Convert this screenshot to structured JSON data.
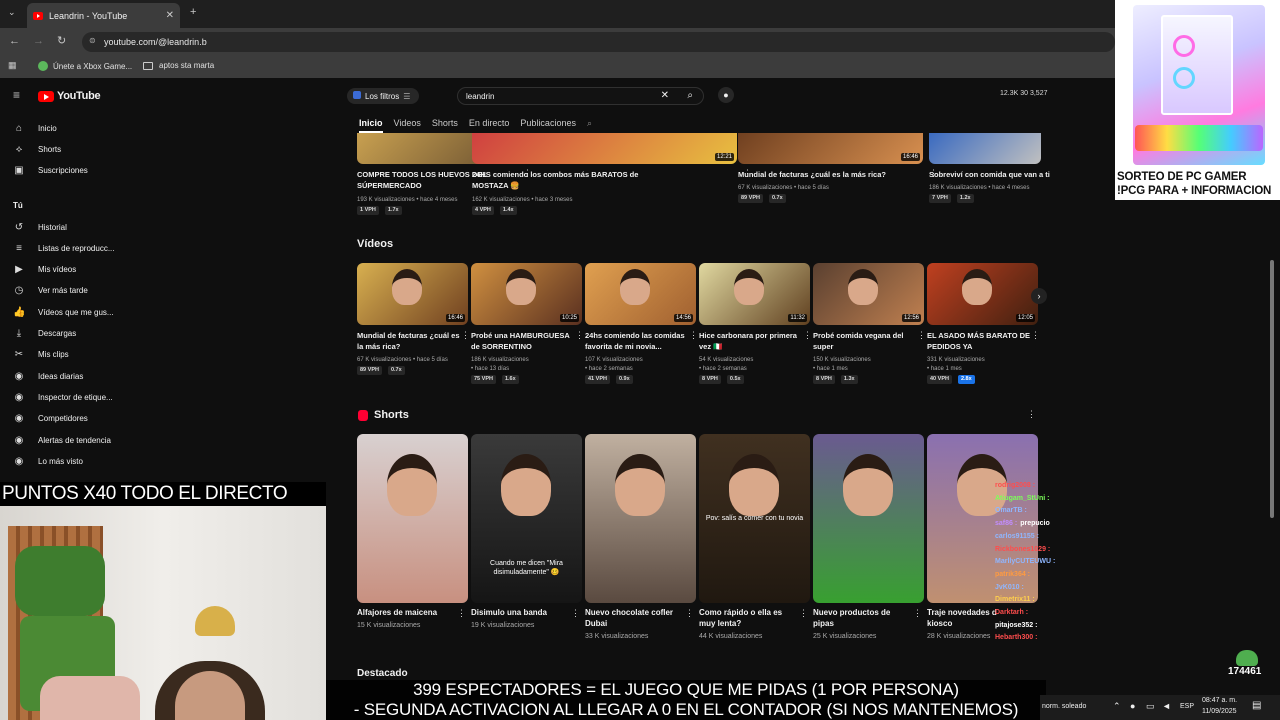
{
  "browser": {
    "tab_title": "Leandrin - YouTube",
    "url": "youtube.com/@leandrin.b",
    "bookmarks": [
      "Únete a Xbox Game...",
      "aptos sta marta"
    ]
  },
  "yt": {
    "logo": "YouTube",
    "filters": "Los filtros",
    "search_value": "leandrin",
    "stats": "12.3K  30  3,527",
    "channel_tabs": [
      "Inicio",
      "Videos",
      "Shorts",
      "En directo",
      "Publicaciones"
    ]
  },
  "sidebar": {
    "items": [
      {
        "icon": "home-icon",
        "label": "Inicio"
      },
      {
        "icon": "shorts-icon",
        "label": "Shorts"
      },
      {
        "icon": "subscriptions-icon",
        "label": "Suscripciones"
      },
      {
        "icon": "",
        "label": "Tú"
      },
      {
        "icon": "history-icon",
        "label": "Historial"
      },
      {
        "icon": "playlist-icon",
        "label": "Listas de reproducc..."
      },
      {
        "icon": "my-videos-icon",
        "label": "Mis vídeos"
      },
      {
        "icon": "watch-later-icon",
        "label": "Ver más tarde"
      },
      {
        "icon": "like-icon",
        "label": "Vídeos que me gus..."
      },
      {
        "icon": "download-icon",
        "label": "Descargas"
      },
      {
        "icon": "clips-icon",
        "label": "Mis clips"
      },
      {
        "icon": "ideas-icon",
        "label": "Ideas diarias"
      },
      {
        "icon": "tag-inspector-icon",
        "label": "Inspector de etique..."
      },
      {
        "icon": "competitors-icon",
        "label": "Competidores"
      },
      {
        "icon": "trend-alerts-icon",
        "label": "Alertas de tendencia"
      },
      {
        "icon": "most-viewed-icon",
        "label": "Lo más visto"
      }
    ]
  },
  "top_row": [
    {
      "title1": "COMPRE TODOS LOS HUEVOS DEL",
      "title2": "SÚPERMERCADO",
      "meta": "193 K visualizaciones • hace 4 meses",
      "vph": "1 VPH",
      "ratio": "1.7x",
      "duration": "13:54"
    },
    {
      "title1": "24HS comiendo los combos más BARATOS de",
      "title2": "MOSTAZA 🍔",
      "meta": "162 K visualizaciones • hace 3 meses",
      "vph": "4 VPH",
      "ratio": "1.4x",
      "duration": "12:21"
    },
    {
      "title1": "Mundial de facturas ¿cuál es la más rica?",
      "title2": "",
      "meta": "67 K visualizaciones • hace 5 días",
      "vph": "89 VPH",
      "ratio": "0.7x",
      "duration": "16:46"
    },
    {
      "title1": "Sobreviví con comida que van a ti",
      "title2": "",
      "meta": "186 K visualizaciones • hace 4 meses",
      "vph": "7 VPH",
      "ratio": "1.2x",
      "duration": ""
    }
  ],
  "videos_section": {
    "title": "Vídeos",
    "items": [
      {
        "title1": "Mundial de facturas ¿cuál es",
        "title2": "la más rica?",
        "meta1": "67 K visualizaciones • hace 5 días",
        "meta2": "",
        "vph": "89 VPH",
        "ratio": "0.7x",
        "duration": "16:46"
      },
      {
        "title1": "Probé una HAMBURGUESA",
        "title2": "de SORRENTINO",
        "meta1": "186 K visualizaciones",
        "meta2": "• hace 13 días",
        "vph": "75 VPH",
        "ratio": "1.6x",
        "duration": "10:25"
      },
      {
        "title1": "24hs comiendo las comidas",
        "title2": "favorita de mi novia...",
        "meta1": "107 K visualizaciones",
        "meta2": "• hace 2 semanas",
        "vph": "41 VPH",
        "ratio": "0.9x",
        "duration": "14:56"
      },
      {
        "title1": "Hice carbonara por primera",
        "title2": "vez 🇮🇹",
        "meta1": "54 K visualizaciones",
        "meta2": "• hace 2 semanas",
        "vph": "8 VPH",
        "ratio": "0.5x",
        "duration": "11:32"
      },
      {
        "title1": "Probé comida vegana del",
        "title2": "super",
        "meta1": "150 K visualizaciones",
        "meta2": "• hace 1 mes",
        "vph": "8 VPH",
        "ratio": "1.3x",
        "duration": "12:56"
      },
      {
        "title1": "EL ASADO MÁS BARATO DE",
        "title2": "PEDIDOS YA",
        "meta1": "331 K visualizaciones",
        "meta2": "• hace 1 mes",
        "vph": "40 VPH",
        "ratio": "2.8x",
        "duration": "12:05"
      }
    ]
  },
  "shorts_section": {
    "title": "Shorts",
    "items": [
      {
        "title1": "Alfajores de maicena",
        "title2": "",
        "meta": "15 K visualizaciones",
        "overlay": ""
      },
      {
        "title1": "Disimulo una banda",
        "title2": "",
        "meta": "19 K visualizaciones",
        "overlay": "Cuando me dicen \"Mira disimuladamente\" 🥴"
      },
      {
        "title1": "Nuevo chocolate cofler",
        "title2": "Dubai",
        "meta": "33 K visualizaciones",
        "overlay": ""
      },
      {
        "title1": "Como rápido o ella es",
        "title2": "muy lenta?",
        "meta": "44 K visualizaciones",
        "overlay": "Pov: salís a comer con tu novia"
      },
      {
        "title1": "Nuevo productos de",
        "title2": "pipas",
        "meta": "25 K visualizaciones",
        "overlay": ""
      },
      {
        "title1": "Traje novedades d",
        "title2": "kiosco",
        "meta": "28 K visualizaciones",
        "overlay": ""
      }
    ]
  },
  "featured_label": "Destacado",
  "overlay": {
    "giveaway_line1": "SORTEO DE PC GAMER",
    "giveaway_line2": "!PCG PARA + INFORMACION",
    "points": "PUNTOS X40 TODO EL DIRECTO",
    "caption1": "399 ESPECTADORES = EL JUEGO QUE ME PIDAS (1 POR PERSONA)",
    "caption2": "- SEGUNDA ACTIVACION AL LLEGAR A 0 EN EL CONTADOR (SI NOS MANTENEMOS)",
    "counter": "174461"
  },
  "chat": [
    {
      "user": "rodrig2008 :",
      "color": "#ff4d4d",
      "msg": ""
    },
    {
      "user": "Atiugam_StUni :",
      "color": "#7cff5a",
      "msg": ""
    },
    {
      "user": "OmarTB :",
      "color": "#8fb6ff",
      "msg": ""
    },
    {
      "user": "saf86 :",
      "color": "#c28dff",
      "msg": "prepucio"
    },
    {
      "user": "carlos91155 :",
      "color": "#8fb6ff",
      "msg": ""
    },
    {
      "user": "Rickbones1029 :",
      "color": "#ff4d4d",
      "msg": ""
    },
    {
      "user": "MarllyCUTEUWU :",
      "color": "#8fb6ff",
      "msg": ""
    },
    {
      "user": "patrik364 :",
      "color": "#ff9b40",
      "msg": ""
    },
    {
      "user": "JvK010 :",
      "color": "#8fb6ff",
      "msg": ""
    },
    {
      "user": "Dimetrix11 :",
      "color": "#ffd04d",
      "msg": ""
    },
    {
      "user": "Darktarh :",
      "color": "#ff4d4d",
      "msg": ""
    },
    {
      "user": "pitajose352 :",
      "color": "#ffffff",
      "msg": ""
    },
    {
      "user": "Hebarth300 :",
      "color": "#ff4d4d",
      "msg": ""
    }
  ],
  "taskbar": {
    "weather": "norm. soleado",
    "lang": "ESP",
    "time": "08:47 a. m.",
    "date": "11/09/2025"
  }
}
